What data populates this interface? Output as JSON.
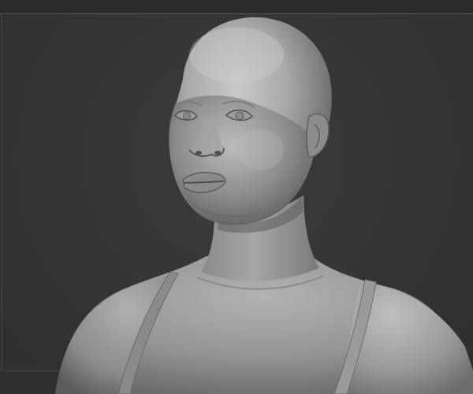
{
  "viewport": {
    "background": "#343434",
    "frame_color": "#5a5a5a"
  },
  "model": {
    "subject": "sculpt-bust",
    "material_color": "#9a9a9a"
  }
}
